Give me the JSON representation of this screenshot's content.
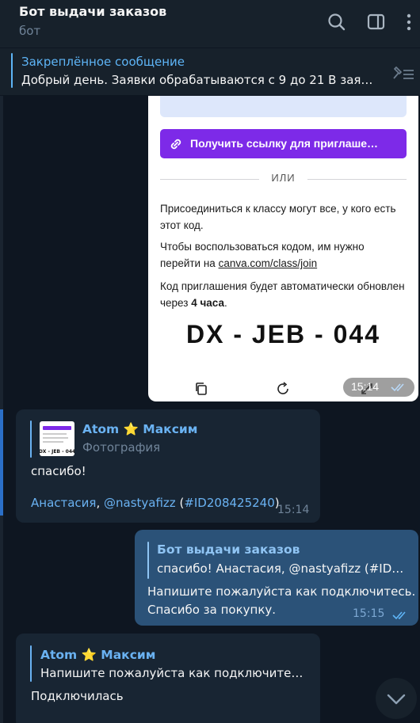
{
  "header": {
    "title": "Бот выдачи заказов",
    "subtitle": "бот"
  },
  "pinned": {
    "label": "Закреплённое сообщение",
    "text": "Добрый день. Заявки обрабатываются с 9 до 21  В заяв…"
  },
  "photo": {
    "invite_button": "Получить ссылку для приглаше…",
    "or_label": "ИЛИ",
    "para1": "Присоединиться к классу могут все, у кого есть этот код.",
    "para2_prefix": "Чтобы воспользоваться кодом, им нужно перейти на ",
    "para2_link": "canva.com/class/join",
    "para3_prefix": "Код приглашения будет автоматически обновлен через ",
    "para3_bold": "4 часа",
    "para3_suffix": ".",
    "code": "DX - JEB - 044",
    "time": "15:14"
  },
  "messages": [
    {
      "reply_name": "Atom ⭐️ Максим",
      "reply_sub": "Фотография",
      "text": "спасибо!",
      "mention_name": "Анастасия",
      "mention_sep": ", ",
      "mention_user": "@nastyafizz",
      "mention_open": " (",
      "mention_id": "#ID208425240",
      "mention_close": ")",
      "time": "15:14"
    },
    {
      "reply_name": "Бот выдачи заказов",
      "reply_text": "спасибо!  Анастасия, @nastyafizz (#ID2…",
      "text_line1": "Напишите пожалуйста как подключитесь.",
      "text_line2": "Спасибо за покупку.",
      "time": "15:15"
    },
    {
      "reply_name": "Atom ⭐️ Максим",
      "reply_text": "Напишите пожалуйста как подключитесь…",
      "text": "Подключилась"
    }
  ],
  "icons": {
    "search": "search-icon",
    "sidebar": "sidebar-toggle-icon",
    "menu": "more-vertical-icon",
    "pin": "pin-list-icon",
    "copy": "copy-icon",
    "refresh": "refresh-icon",
    "expand": "expand-icon",
    "scroll": "chevron-down-icon"
  },
  "colors": {
    "accent": "#5eb5f7",
    "background": "#0e1621",
    "incoming_bubble": "#182533",
    "outgoing_bubble": "#2b5278",
    "canva_purple": "#7d2ae8"
  }
}
